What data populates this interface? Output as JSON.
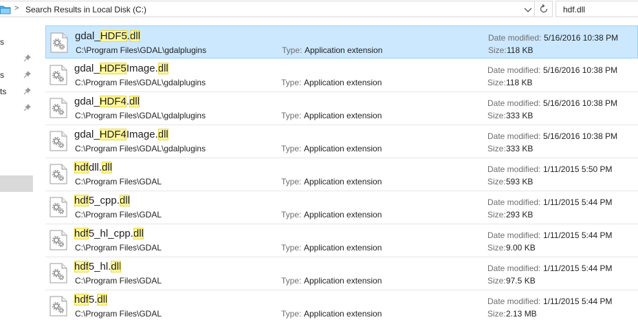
{
  "address": {
    "separator": ">",
    "path": "Search Results in Local Disk (C:)"
  },
  "search": {
    "query": "hdf.dll"
  },
  "nav": {
    "items": [
      {
        "label": "s",
        "pinned": false
      },
      {
        "label": "s",
        "pinned": true
      },
      {
        "label": "ts",
        "pinned": true
      },
      {
        "label": "",
        "pinned": true
      },
      {
        "label": "",
        "pinned": true
      }
    ]
  },
  "labels": {
    "type": "Type:",
    "date_modified": "Date modified:",
    "size": "Size:"
  },
  "files": [
    {
      "name_parts": [
        [
          "gdal_",
          false
        ],
        [
          "HDF5",
          true
        ],
        [
          ".",
          false
        ],
        [
          "dll",
          true
        ]
      ],
      "path": "C:\\Program Files\\GDAL\\gdalplugins",
      "type": "Application extension",
      "date": "5/16/2016 10:38 PM",
      "size": "118 KB",
      "selected": true
    },
    {
      "name_parts": [
        [
          "gdal_",
          false
        ],
        [
          "HDF5",
          true
        ],
        [
          "Image.",
          false
        ],
        [
          "dll",
          true
        ]
      ],
      "path": "C:\\Program Files\\GDAL\\gdalplugins",
      "type": "Application extension",
      "date": "5/16/2016 10:38 PM",
      "size": "118 KB",
      "selected": false
    },
    {
      "name_parts": [
        [
          "gdal_",
          false
        ],
        [
          "HDF4",
          true
        ],
        [
          ".",
          false
        ],
        [
          "dll",
          true
        ]
      ],
      "path": "C:\\Program Files\\GDAL\\gdalplugins",
      "type": "Application extension",
      "date": "5/16/2016 10:38 PM",
      "size": "333 KB",
      "selected": false
    },
    {
      "name_parts": [
        [
          "gdal_",
          false
        ],
        [
          "HDF4",
          true
        ],
        [
          "Image.",
          false
        ],
        [
          "dll",
          true
        ]
      ],
      "path": "C:\\Program Files\\GDAL\\gdalplugins",
      "type": "Application extension",
      "date": "5/16/2016 10:38 PM",
      "size": "333 KB",
      "selected": false
    },
    {
      "name_parts": [
        [
          "hdf",
          true
        ],
        [
          "dll.",
          false
        ],
        [
          "dll",
          true
        ]
      ],
      "path": "C:\\Program Files\\GDAL",
      "type": "Application extension",
      "date": "1/11/2015 5:50 PM",
      "size": "593 KB",
      "selected": false
    },
    {
      "name_parts": [
        [
          "hdf",
          true
        ],
        [
          "5_cpp.",
          false
        ],
        [
          "dll",
          true
        ]
      ],
      "path": "C:\\Program Files\\GDAL",
      "type": "Application extension",
      "date": "1/11/2015 5:44 PM",
      "size": "293 KB",
      "selected": false
    },
    {
      "name_parts": [
        [
          "hdf",
          true
        ],
        [
          "5_hl_cpp.",
          false
        ],
        [
          "dll",
          true
        ]
      ],
      "path": "C:\\Program Files\\GDAL",
      "type": "Application extension",
      "date": "1/11/2015 5:44 PM",
      "size": "9.00 KB",
      "selected": false
    },
    {
      "name_parts": [
        [
          "hdf",
          true
        ],
        [
          "5_hl.",
          false
        ],
        [
          "dll",
          true
        ]
      ],
      "path": "C:\\Program Files\\GDAL",
      "type": "Application extension",
      "date": "1/11/2015 5:44 PM",
      "size": "97.5 KB",
      "selected": false
    },
    {
      "name_parts": [
        [
          "hdf",
          true
        ],
        [
          "5.",
          false
        ],
        [
          "dll",
          true
        ]
      ],
      "path": "C:\\Program Files\\GDAL",
      "type": "Application extension",
      "date": "1/11/2015 5:44 PM",
      "size": "2.13 MB",
      "selected": false
    }
  ],
  "colors": {
    "selected_bg": "#cce8ff",
    "selected_border": "#99d1ff",
    "highlight": "#fff799"
  },
  "icons": {
    "folder": "folder-icon",
    "dropdown": "chevron-down-icon",
    "refresh": "refresh-icon",
    "pin": "pin-icon",
    "file": "dll-file-icon"
  }
}
